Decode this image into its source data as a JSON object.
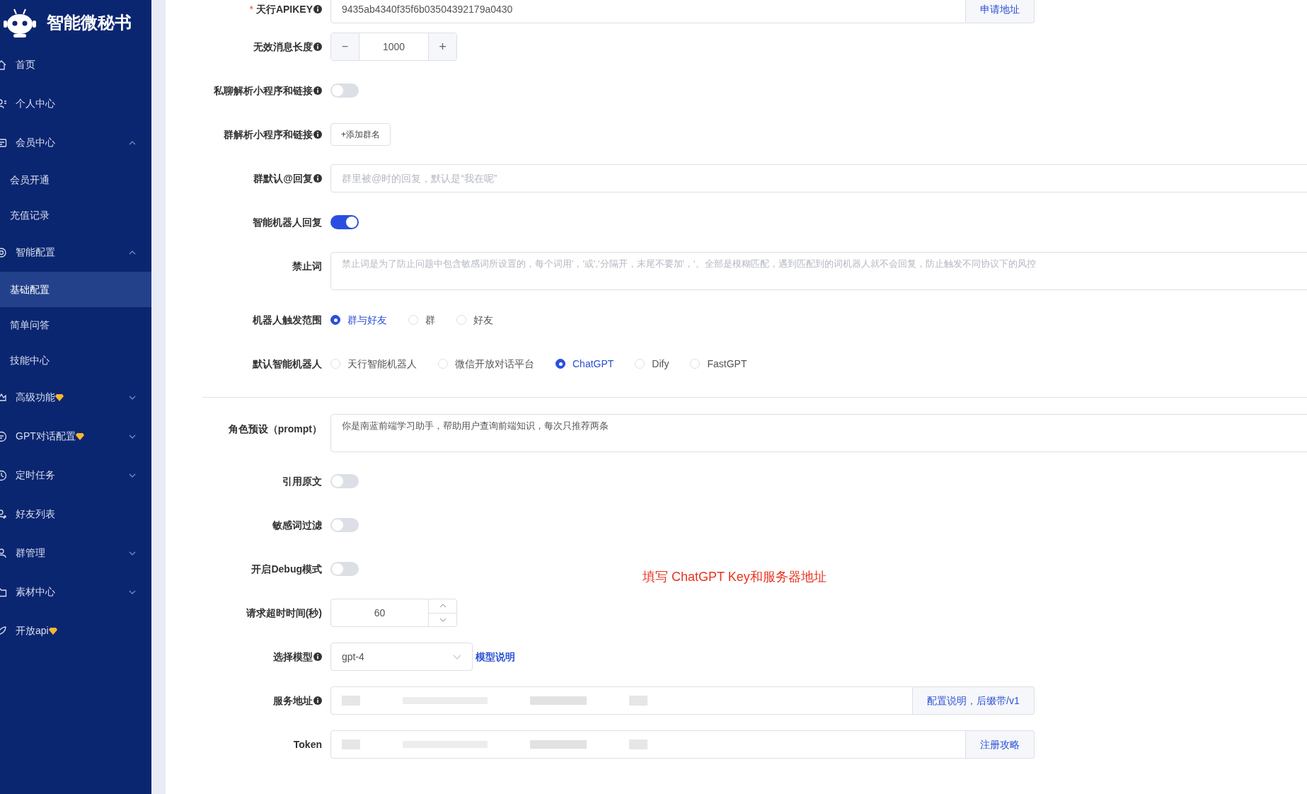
{
  "app": {
    "title": "智能微秘书"
  },
  "sidebar": {
    "items": [
      {
        "label": "首页",
        "selected": false
      },
      {
        "label": "个人中心",
        "selected": false
      },
      {
        "label": "会员中心",
        "selected": false,
        "expanded": true,
        "children": [
          {
            "label": "会员开通",
            "selected": false
          },
          {
            "label": "充值记录",
            "selected": false
          }
        ]
      },
      {
        "label": "智能配置",
        "selected": false,
        "expanded": true,
        "children": [
          {
            "label": "基础配置",
            "selected": true
          },
          {
            "label": "简单问答",
            "selected": false
          },
          {
            "label": "技能中心",
            "selected": false
          }
        ]
      },
      {
        "label": "高级功能",
        "selected": false,
        "premium": true,
        "expanded": false
      },
      {
        "label": "GPT对话配置",
        "selected": false,
        "premium": true,
        "expanded": false
      },
      {
        "label": "定时任务",
        "selected": false,
        "expanded": false
      },
      {
        "label": "好友列表",
        "selected": false
      },
      {
        "label": "群管理",
        "selected": false,
        "expanded": false
      },
      {
        "label": "素材中心",
        "selected": false,
        "expanded": false
      },
      {
        "label": "开放api",
        "selected": false,
        "premium": true
      }
    ]
  },
  "form": {
    "rows": [
      {
        "kind": "input",
        "label": "天行APIKEY",
        "required_mark": "*",
        "info": true,
        "value": "9435ab4340f35f6b03504392179a0430",
        "addon": "申请地址"
      },
      {
        "kind": "stepper",
        "label": "无效消息长度",
        "info": true,
        "minus": "−",
        "value": "1000",
        "plus": "+"
      },
      {
        "kind": "switch",
        "label": "私聊解析小程序和链接",
        "info": true,
        "on": false
      },
      {
        "kind": "button",
        "label": "群解析小程序和链接",
        "info": true,
        "button": "+添加群名"
      },
      {
        "kind": "input",
        "label": "群默认@回复",
        "info": true,
        "placeholder": "群里被@时的回复，默认是“我在呢”"
      },
      {
        "kind": "switch",
        "label": "智能机器人回复",
        "on": true
      },
      {
        "kind": "textarea",
        "label": "禁止词",
        "placeholder": "禁止词是为了防止问题中包含敏感词所设置的，每个词用'，'或','分隔开，末尾不要加'，'。全部是模糊匹配，遇到匹配到的词机器人就不会回复，防止触发不同协议下的风控"
      },
      {
        "kind": "radio",
        "label": "机器人触发范围",
        "options": [
          {
            "label": "群与好友",
            "selected": true
          },
          {
            "label": "群",
            "selected": false
          },
          {
            "label": "好友",
            "selected": false
          }
        ]
      },
      {
        "kind": "radio",
        "label": "默认智能机器人",
        "options": [
          {
            "label": "天行智能机器人",
            "selected": false
          },
          {
            "label": "微信开放对话平台",
            "selected": false
          },
          {
            "label": "ChatGPT",
            "selected": true
          },
          {
            "label": "Dify",
            "selected": false
          },
          {
            "label": "FastGPT",
            "selected": false
          }
        ]
      },
      {
        "kind": "divider"
      },
      {
        "kind": "textarea",
        "label": "角色预设（prompt）",
        "value": "你是南蓝前端学习助手，帮助用户查询前端知识，每次只推荐两条"
      },
      {
        "kind": "switch",
        "label": "引用原文",
        "on": false
      },
      {
        "kind": "switch",
        "label": "敏感词过滤",
        "on": false
      },
      {
        "kind": "switch",
        "label": "开启Debug模式",
        "on": false
      },
      {
        "kind": "number",
        "label": "请求超时时间(秒)",
        "value": "60"
      },
      {
        "kind": "select",
        "label": "选择模型",
        "info": true,
        "value": "gpt-4",
        "link": "模型说明"
      },
      {
        "kind": "input",
        "label": "服务地址",
        "info": true,
        "redacted": true,
        "addon": "配置说明，后缀带/v1"
      },
      {
        "kind": "input",
        "label": "Token",
        "redacted": true,
        "addon": "注册攻略"
      }
    ]
  },
  "annotation": {
    "text": "填写 ChatGPT Key和服务器地址"
  }
}
